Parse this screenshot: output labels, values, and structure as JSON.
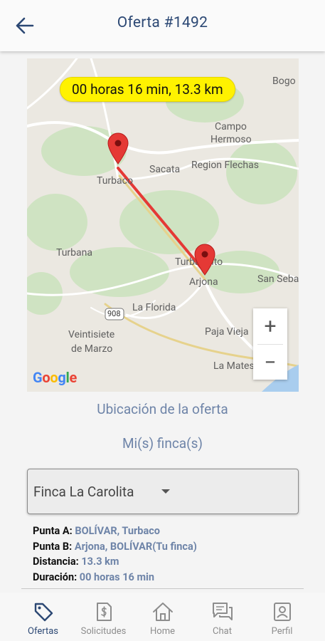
{
  "header": {
    "title": "Oferta #1492"
  },
  "map": {
    "route_badge": "00 horas 16 min, 13.3 km",
    "labels": {
      "bogo": "Bogo",
      "campo_hermoso_1": "Campo",
      "campo_hermoso_2": "Hermoso",
      "turbaco": "Turbaco",
      "sacata": "Sacata",
      "region_flechas": "Region Flechas",
      "turbana": "Turbana",
      "turbaquito": "Turbaquito",
      "arjona": "Arjona",
      "san_seba": "San Seba",
      "la_florida": "La Florida",
      "veintisiete_1": "Veintisiete",
      "veintisiete_2": "de Marzo",
      "paja_vieja": "Paja Vieja",
      "la_mates": "La Mates",
      "road_908": "908"
    },
    "zoom_in": "+",
    "zoom_out": "−",
    "google": [
      "G",
      "o",
      "o",
      "g",
      "l",
      "e"
    ]
  },
  "links": {
    "location": "Ubicación de la oferta",
    "farms": "Mi(s) finca(s)"
  },
  "dropdown": {
    "selected": "Finca La Carolita"
  },
  "details": {
    "punta_a_label": "Punta A:",
    "punta_a_value": "BOLÍVAR, Turbaco",
    "punta_b_label": "Punta B:",
    "punta_b_value": "Arjona, BOLÍVAR(Tu finca)",
    "distancia_label": "Distancia:",
    "distancia_value": "13.3 km",
    "duracion_label": "Duración:",
    "duracion_value": "00 horas 16 min"
  },
  "nav": {
    "items": [
      {
        "label": "Ofertas",
        "icon": "tag-icon",
        "active": true
      },
      {
        "label": "Solicitudes",
        "icon": "invoice-icon",
        "active": false
      },
      {
        "label": "Home",
        "icon": "home-icon",
        "active": false
      },
      {
        "label": "Chat",
        "icon": "chat-icon",
        "active": false
      },
      {
        "label": "Perfil",
        "icon": "profile-icon",
        "active": false
      }
    ]
  },
  "colors": {
    "primary": "#2c4874",
    "link": "#6e84a8",
    "badge": "#fff200",
    "route": "#e53935"
  }
}
